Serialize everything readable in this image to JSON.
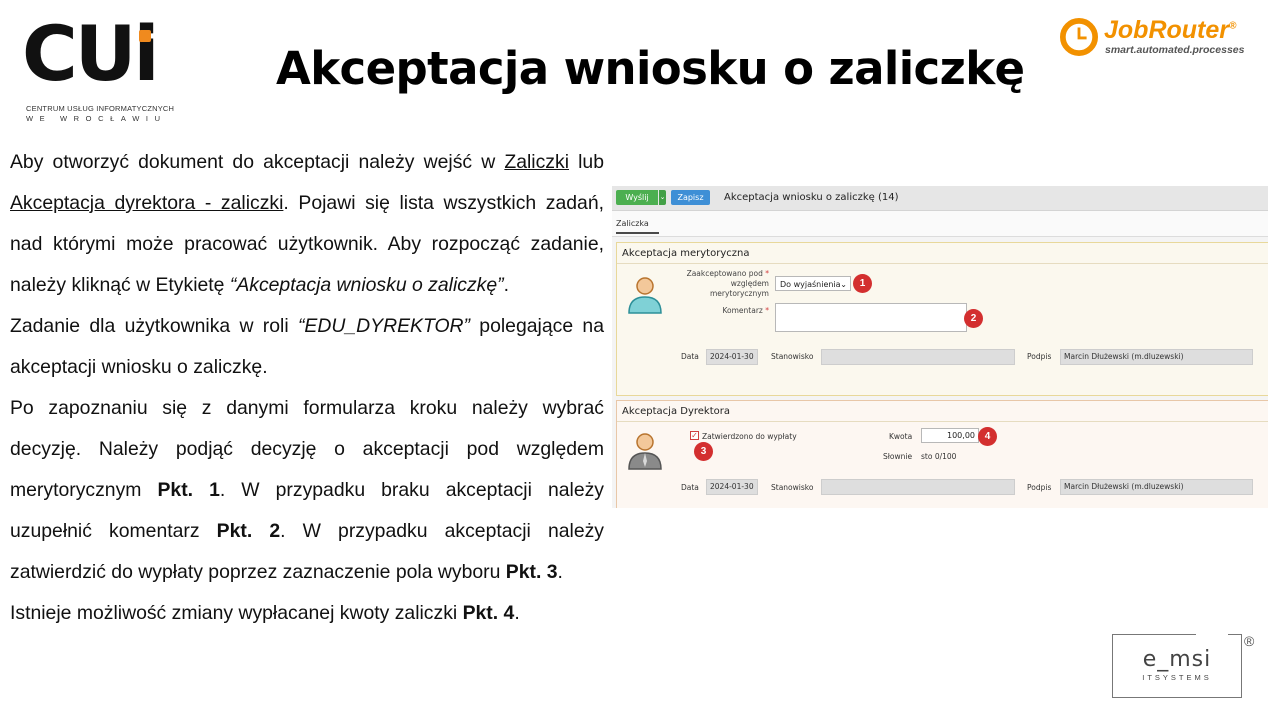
{
  "header": {
    "cui_logo_word": "CUi",
    "cui_logo_line1": "CENTRUM USŁUG INFORMATYCZNYCH",
    "cui_logo_line2": "WE WROCŁAWIU",
    "title": "Akceptacja wniosku o zaliczkę",
    "jobrouter_name": "JobRouter",
    "jobrouter_reg": "®",
    "jobrouter_tagline": "smart.automated.processes",
    "accent_color": "#f29100"
  },
  "body": {
    "p1_a": "Aby otworzyć dokument do akceptacji należy wejść w ",
    "p1_link1": "Zaliczki",
    "p1_b": " lub ",
    "p1_link2": "Akceptacja dyrektora - zaliczki",
    "p1_c": ". Pojawi się lista wszystkich zadań, nad którymi może pracować użytkownik. Aby rozpocząć zadanie, należy kliknąć w Etykietę ",
    "p1_quote": "“Akceptacja wniosku o zaliczkę”",
    "p1_d": ".",
    "p2_a": "Zadanie dla użytkownika w roli ",
    "p2_role": "“EDU_DYREKTOR”",
    "p2_b": " polegające na akceptacji wniosku o zaliczkę.",
    "p3_a": "Po zapoznaniu się z danymi formularza kroku należy wybrać decyzję. Należy podjąć decyzję o akceptacji pod względem merytorycznym ",
    "p3_pkt1": "Pkt. 1",
    "p3_b": ". W przypadku braku akceptacji należy uzupełnić komentarz ",
    "p3_pkt2": "Pkt. 2",
    "p3_c": ". W przypadku akceptacji należy zatwierdzić do wypłaty poprzez zaznaczenie pola wyboru ",
    "p3_pkt3": "Pkt. 3",
    "p3_d": ".",
    "p4_a": "Istnieje możliwość zmiany wypłacanej kwoty zaliczki ",
    "p4_pkt4": "Pkt. 4",
    "p4_b": "."
  },
  "screenshot": {
    "send_label": "Wyślij",
    "send_arrow": "⌄",
    "save_label": "Zapisz",
    "window_title": "Akceptacja wniosku o zaliczkę (14)",
    "tab_label": "Zaliczka",
    "panel1": {
      "title": "Akceptacja merytoryczna",
      "decision_label_1": "Zaakceptowano pod",
      "decision_label_2": "względem",
      "decision_label_3": "merytorycznym",
      "required_mark": "*",
      "decision_value": "Do wyjaśnienia",
      "comment_label": "Komentarz",
      "date_label": "Data",
      "date_value": "2024-01-30",
      "position_label": "Stanowisko",
      "position_value": "",
      "signature_label": "Podpis",
      "signature_value": "Marcin Dłużewski (m.dluzewski)",
      "badge1": "1",
      "badge2": "2"
    },
    "panel2": {
      "title": "Akceptacja Dyrektora",
      "checkbox_label": "Zatwierdzono do wypłaty",
      "checkbox_mark": "✓",
      "amount_label": "Kwota",
      "amount_value": "100,00",
      "words_label": "Słownie",
      "words_value": "sto 0/100",
      "date_label": "Data",
      "date_value": "2024-01-30",
      "position_label": "Stanowisko",
      "position_value": "",
      "signature_label": "Podpis",
      "signature_value": "Marcin Dłużewski (m.dluzewski)",
      "badge3": "3",
      "badge4": "4"
    },
    "badge_color": "#d32f2f"
  },
  "footer": {
    "emsi_word": "e_msi",
    "emsi_sub": "ITSYSTEMS",
    "emsi_reg": "®"
  }
}
